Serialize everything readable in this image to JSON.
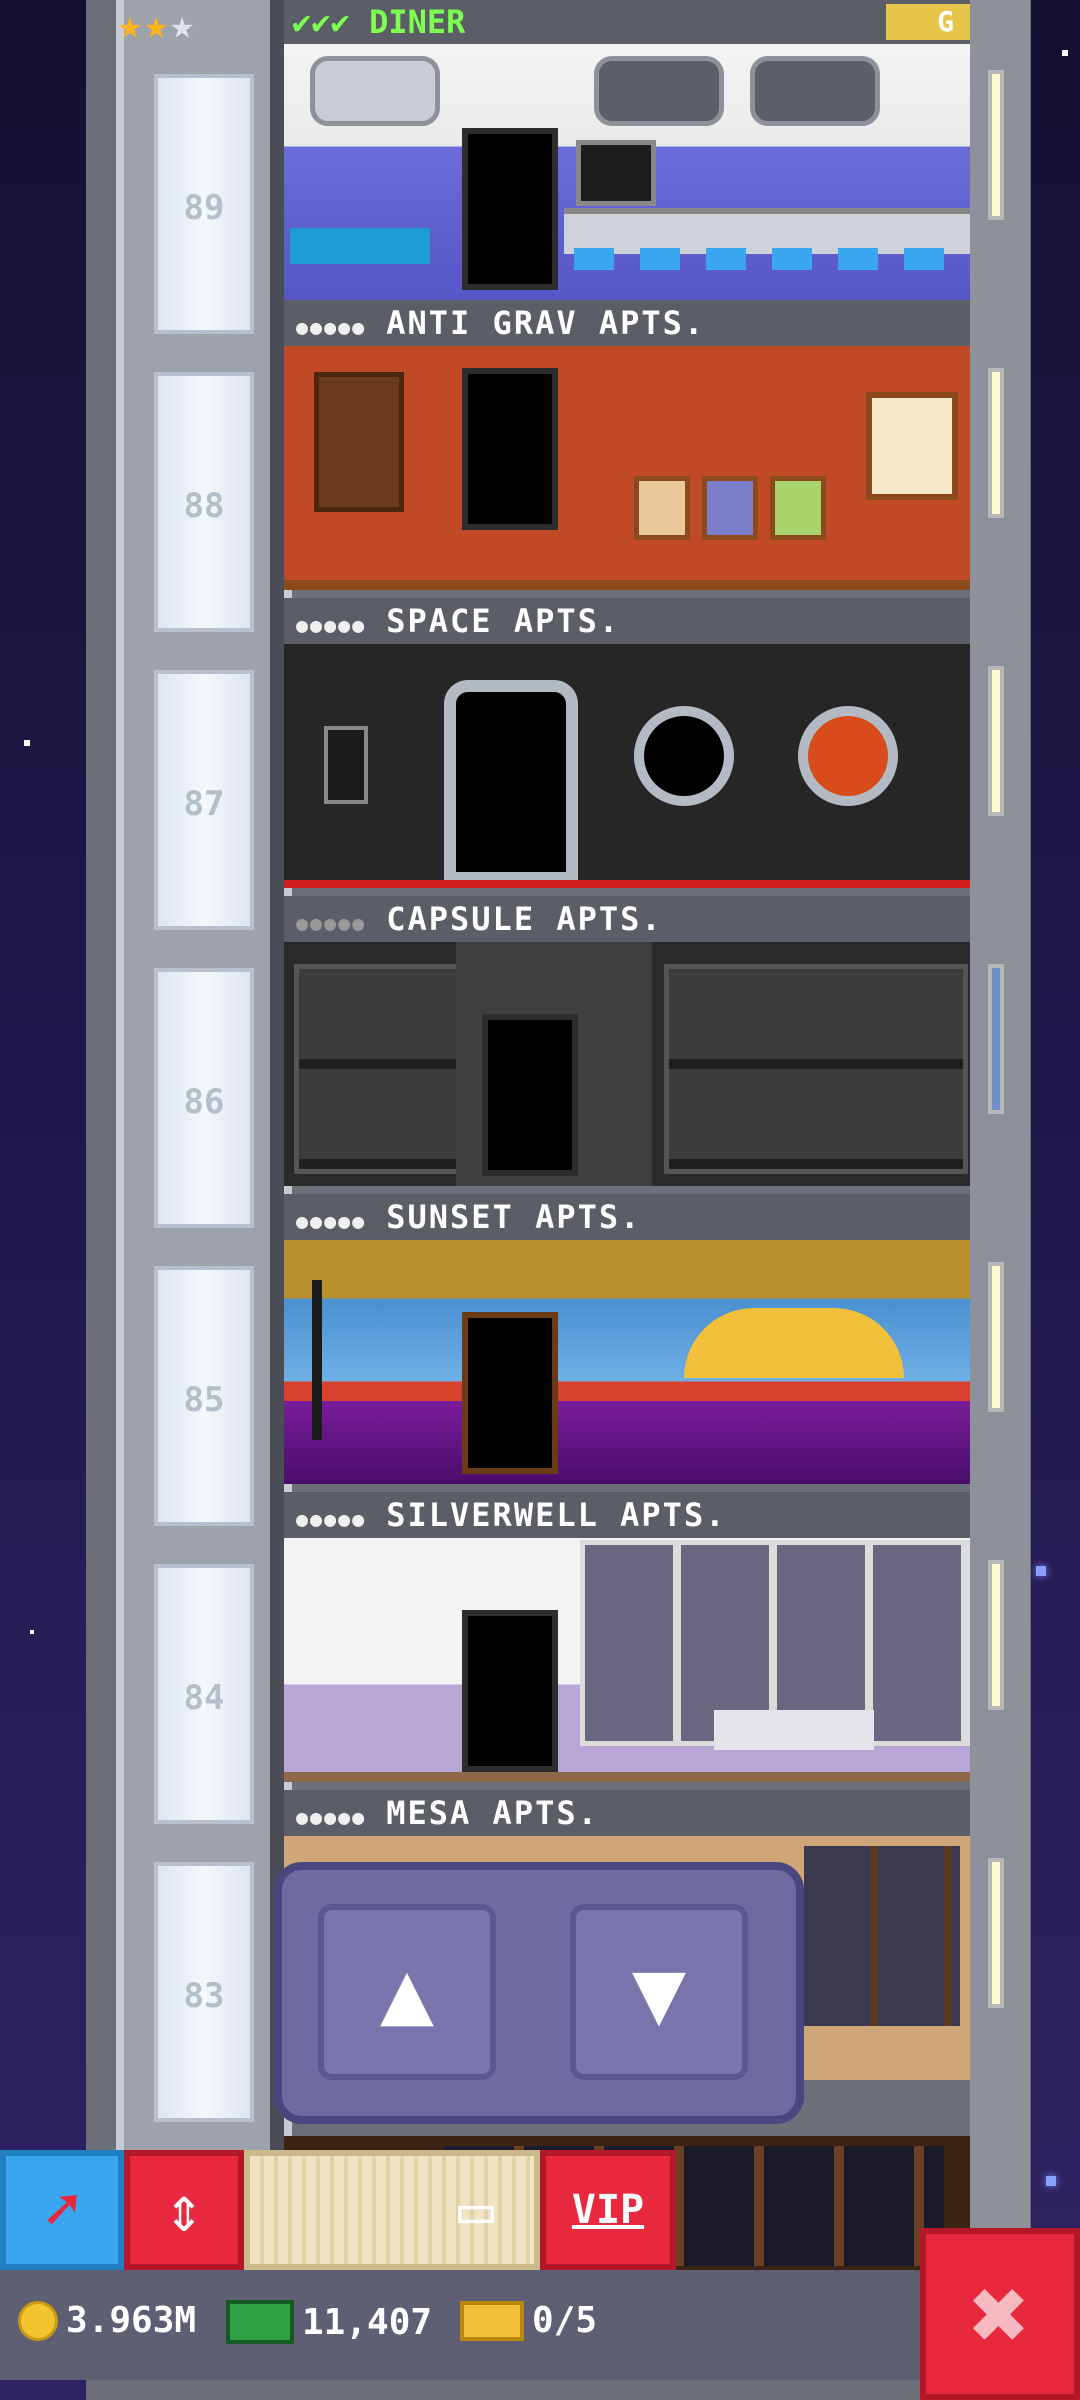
{
  "header": {
    "rating_stars": "★★",
    "rating_empty_star": "★",
    "checks": "✔✔✔",
    "floor_name": "DINER",
    "badge": "G"
  },
  "floors": [
    {
      "number": "89",
      "name": "DINER"
    },
    {
      "number": "88",
      "name": "ANTI GRAV APTS."
    },
    {
      "number": "87",
      "name": "SPACE APTS."
    },
    {
      "number": "86",
      "name": "CAPSULE APTS."
    },
    {
      "number": "85",
      "name": "SUNSET APTS."
    },
    {
      "number": "84",
      "name": "SILVERWELL APTS."
    },
    {
      "number": "83",
      "name": "MESA APTS."
    }
  ],
  "resident_dots": "●●●●●",
  "elevator_controls": {
    "up_icon": "▲",
    "down_icon": "▼"
  },
  "toolbar": {
    "items": [
      {
        "name": "move-tool",
        "icon": "➚"
      },
      {
        "name": "elevator-tool",
        "icon": "⇕"
      },
      {
        "name": "storage-tool",
        "icon": "▭"
      },
      {
        "name": "vip",
        "label": "VIP"
      }
    ]
  },
  "status": {
    "coins": "3.963M",
    "bux": "11,407",
    "tickets": "0/5"
  },
  "close_icon": "✖",
  "colors": {
    "accent_red": "#e8283c",
    "accent_blue": "#3aa6f0",
    "check_green": "#7dff4f",
    "coin_gold": "#f4c430"
  }
}
